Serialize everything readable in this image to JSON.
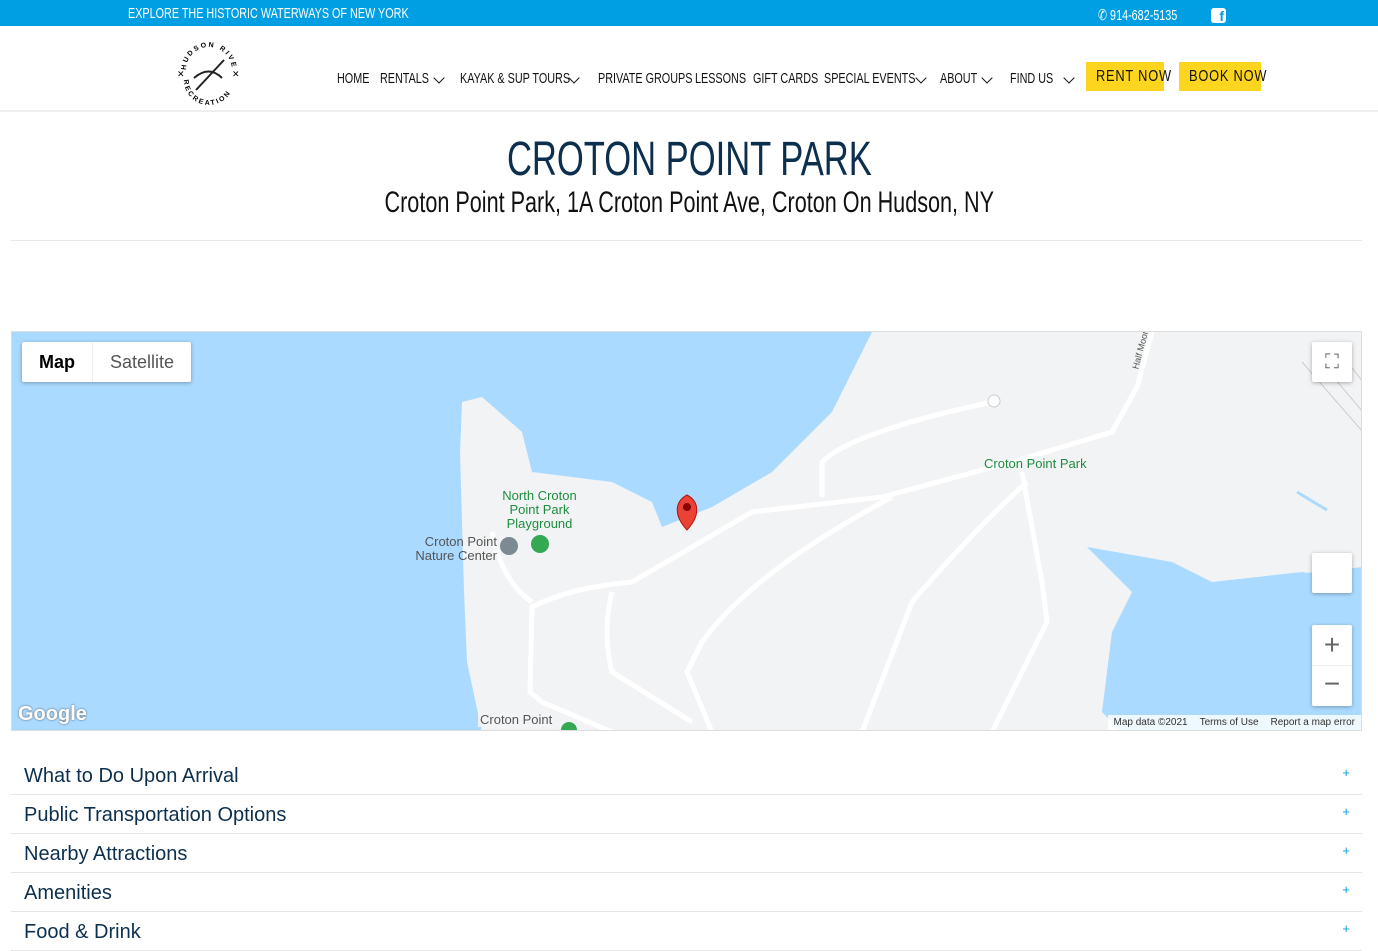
{
  "topbar": {
    "tagline": "EXPLORE THE HISTORIC WATERWAYS OF NEW YORK",
    "phone": "914-682-5135",
    "facebook_icon": "facebook-icon"
  },
  "logo": {
    "text_top": "HUDSON RIVER",
    "text_bottom": "RECREATION"
  },
  "nav": [
    {
      "label": "HOME"
    },
    {
      "label": "RENTALS",
      "dropdown": true
    },
    {
      "label": "KAYAK & SUP TOURS",
      "dropdown": true
    },
    {
      "label": "PRIVATE GROUPS"
    },
    {
      "label": "LESSONS"
    },
    {
      "label": "GIFT CARDS"
    },
    {
      "label": "SPECIAL EVENTS",
      "dropdown": true
    },
    {
      "label": "ABOUT",
      "dropdown": true
    },
    {
      "label": "FIND US",
      "dropdown": true
    }
  ],
  "buttons": {
    "rent": "RENT NOW",
    "book": "BOOK NOW"
  },
  "colors": {
    "accent": "#009fe3",
    "button": "#fdd51f",
    "heading": "#0c2f4e"
  },
  "page": {
    "title": "CROTON POINT PARK",
    "address": "Croton Point Park, 1A Croton Point Ave, Croton On Hudson, NY"
  },
  "map": {
    "type_map": "Map",
    "type_satellite": "Satellite",
    "labels": {
      "playground": "North Croton Point Park Playground",
      "nature_center": "Croton Point Nature Center",
      "park": "Croton Point Park",
      "road": "Half Moon",
      "bottom": "Croton Point"
    },
    "attribution": {
      "data": "Map data ©2021",
      "terms": "Terms of Use",
      "report": "Report a map error"
    },
    "google": "Google"
  },
  "accordion": [
    {
      "title": "What to Do Upon Arrival"
    },
    {
      "title": "Public Transportation Options"
    },
    {
      "title": "Nearby Attractions"
    },
    {
      "title": "Amenities"
    },
    {
      "title": "Food & Drink"
    }
  ],
  "plus": "+"
}
